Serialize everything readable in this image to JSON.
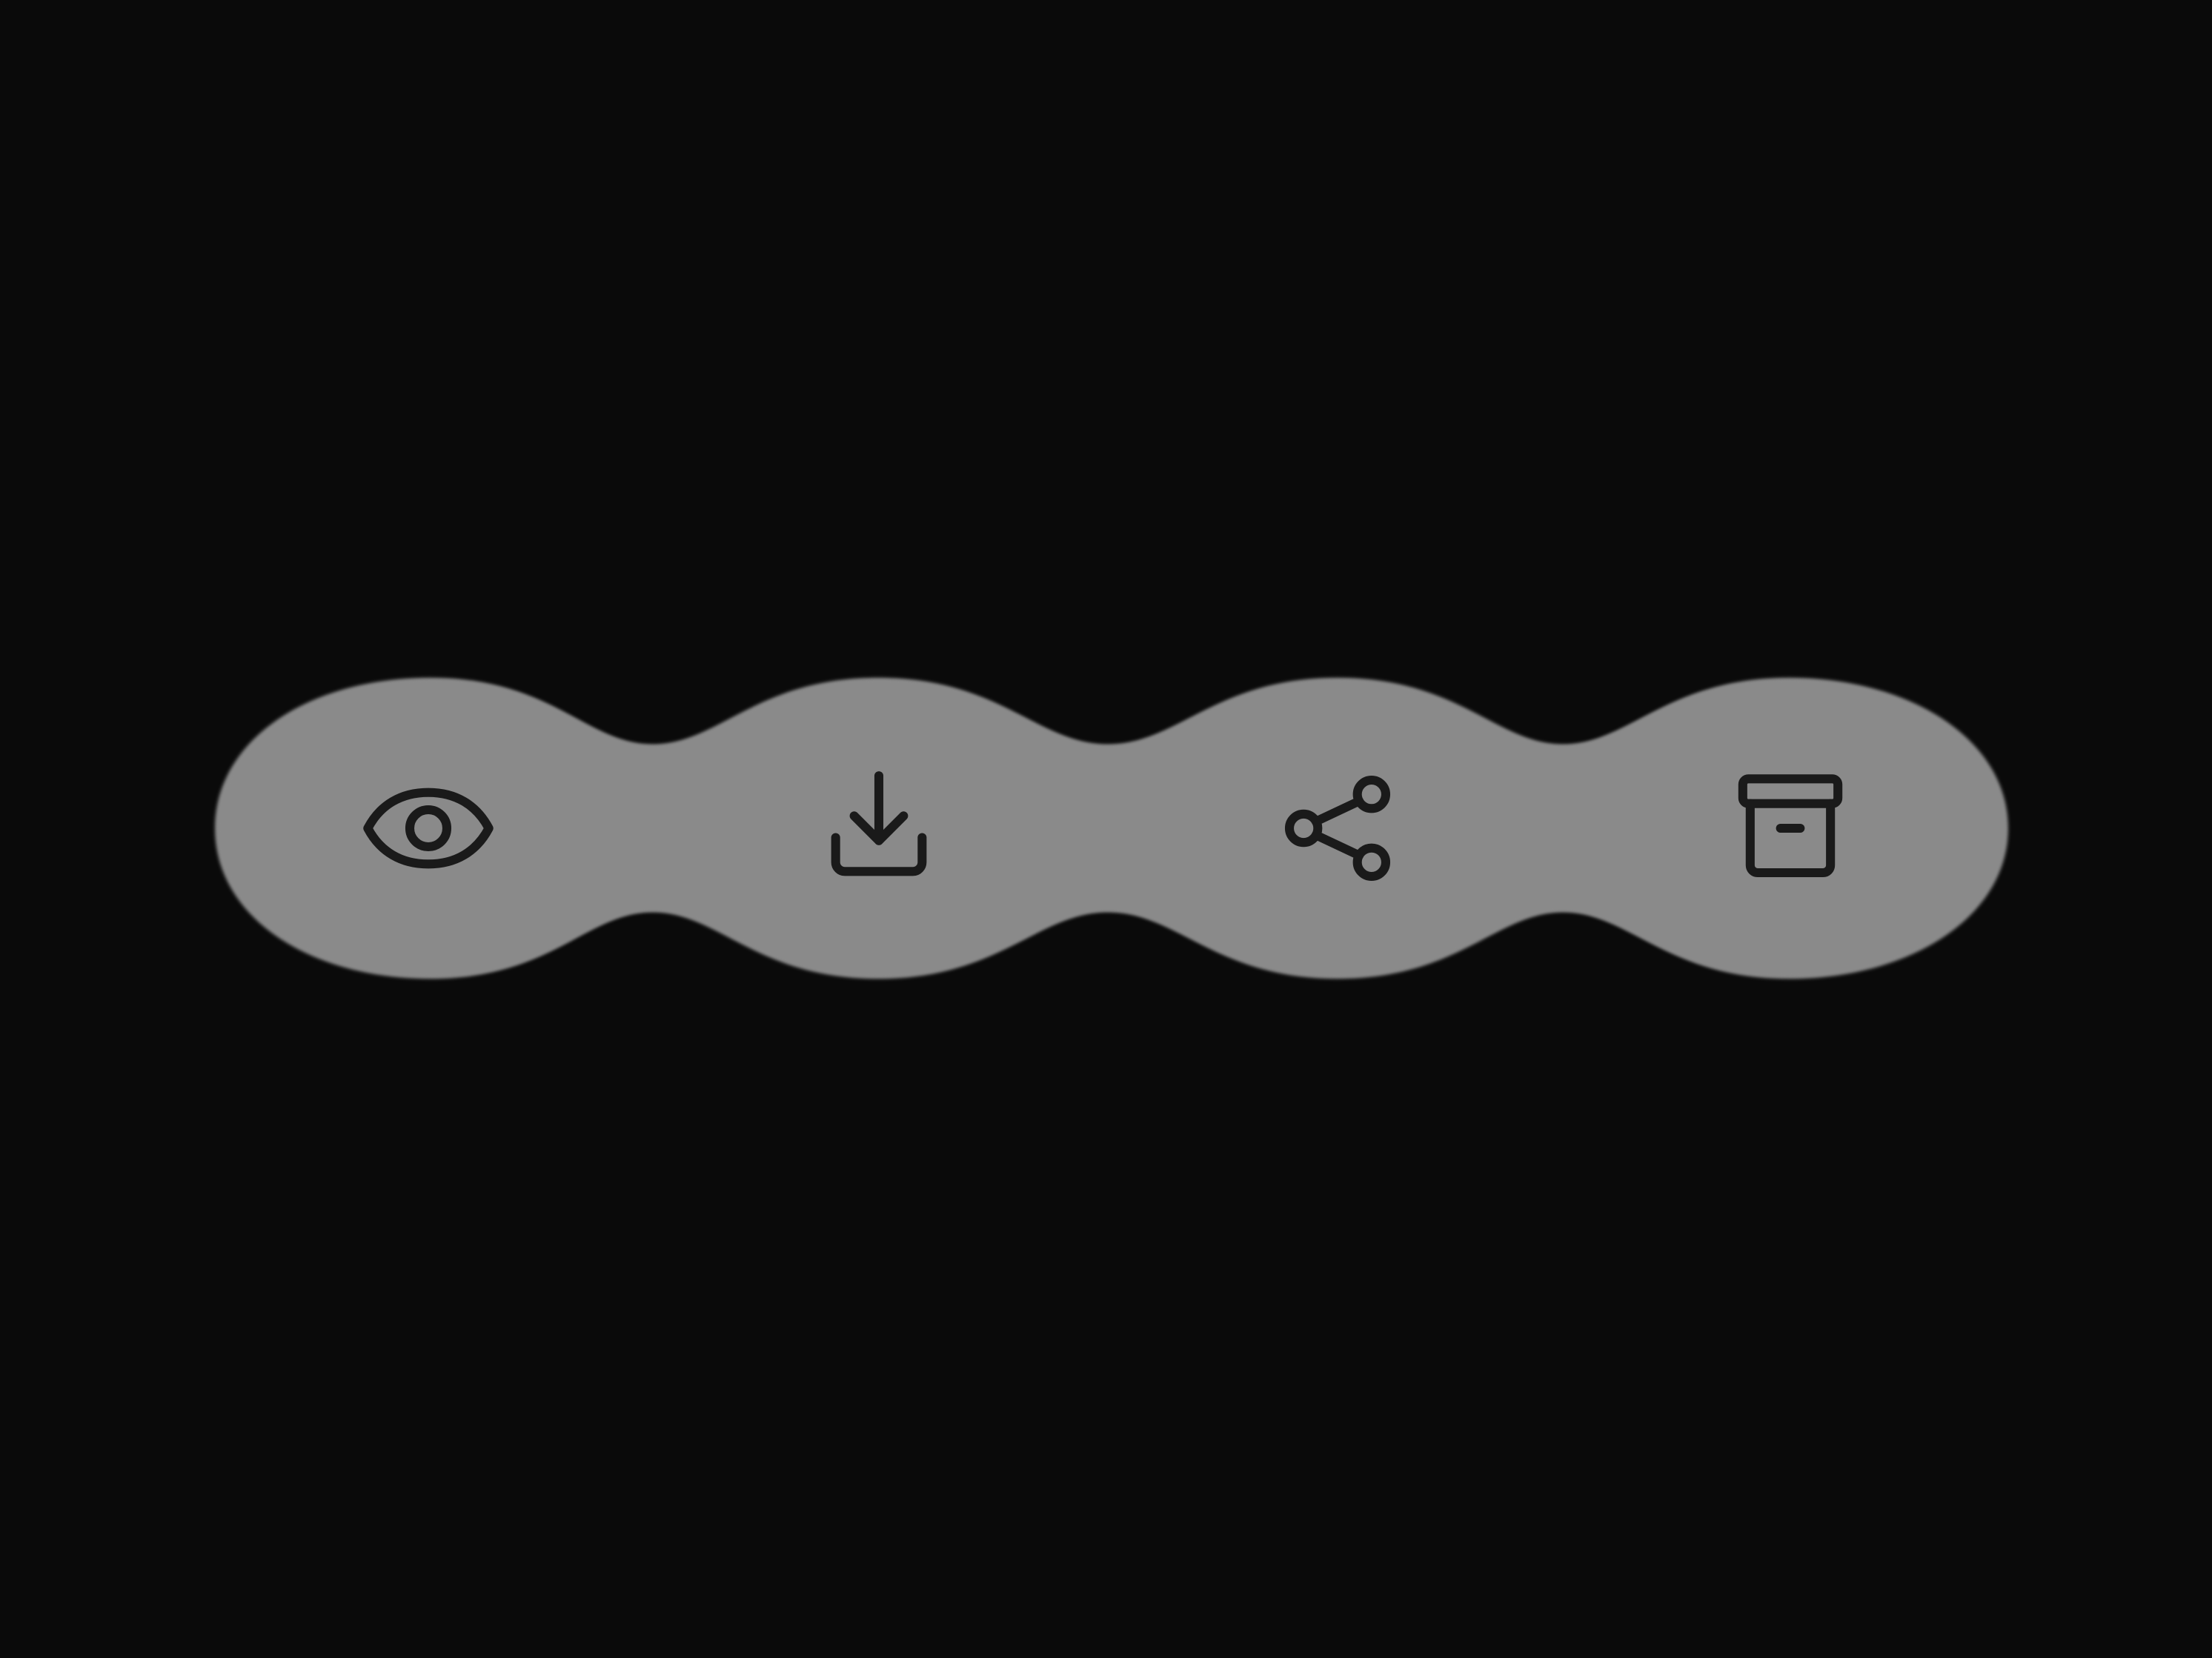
{
  "colors": {
    "background": "#0a0a0a",
    "bar_fill": "#e5e5e5",
    "bar_edge": "#8a8a8a",
    "icon_stroke": "#1a1a1a"
  },
  "actions": [
    {
      "id": "view",
      "icon": "eye-icon"
    },
    {
      "id": "download",
      "icon": "download-icon"
    },
    {
      "id": "share",
      "icon": "share-icon"
    },
    {
      "id": "archive",
      "icon": "archive-icon"
    }
  ]
}
